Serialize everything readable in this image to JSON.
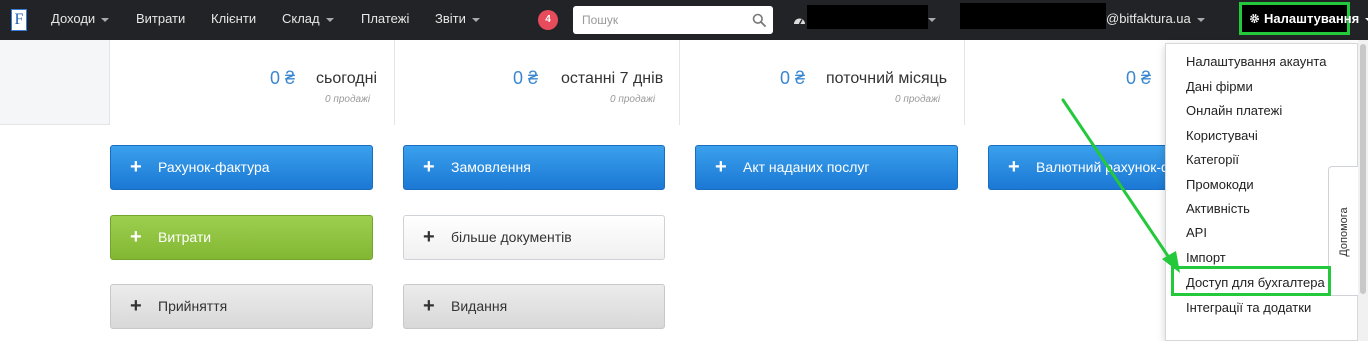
{
  "nav": {
    "logo": "F",
    "items": [
      {
        "label": "Доходи",
        "dropdown": true
      },
      {
        "label": "Витрати",
        "dropdown": false
      },
      {
        "label": "Клієнти",
        "dropdown": false
      },
      {
        "label": "Склад",
        "dropdown": true
      },
      {
        "label": "Платежі",
        "dropdown": false
      },
      {
        "label": "Звіти",
        "dropdown": true
      }
    ],
    "notification_count": "4",
    "search_placeholder": "Пошук",
    "email_suffix": "@bitfaktura.ua",
    "settings_label": "Налаштування",
    "icons": [
      "search-icon",
      "dashboard-icon",
      "gear-icon"
    ]
  },
  "stats": [
    {
      "value": "0 ₴",
      "label": "сьогодні",
      "sub": "0 продажі"
    },
    {
      "value": "0 ₴",
      "label": "останні 7 днів",
      "sub": "0 продажі"
    },
    {
      "value": "0 ₴",
      "label": "поточний місяць",
      "sub": "0 продажі"
    },
    {
      "value": "0 ₴",
      "label": "",
      "sub": ""
    }
  ],
  "buttons": {
    "invoice": "Рахунок-фактура",
    "order": "Замовлення",
    "act": "Акт наданих послуг",
    "currency_invoice": "Валютний рахунок-ф",
    "expenses": "Витрати",
    "more_docs": "більше документів",
    "receipt": "Прийняття",
    "issue": "Видання",
    "plus": "+"
  },
  "settings_menu": [
    "Налаштування акаунта",
    "Дані фірми",
    "Онлайн платежі",
    "Користувачі",
    "Категорії",
    "Промокоди",
    "Активність",
    "API",
    "Імпорт",
    "Доступ для бухгалтера",
    "Інтеграції та додатки"
  ],
  "help_tab": "Допомога",
  "colors": {
    "navbar": "#222326",
    "accent_blue": "#1b78d4",
    "green_button": "#8cc63f",
    "highlight": "#23c93a",
    "badge": "#e74c5c"
  }
}
